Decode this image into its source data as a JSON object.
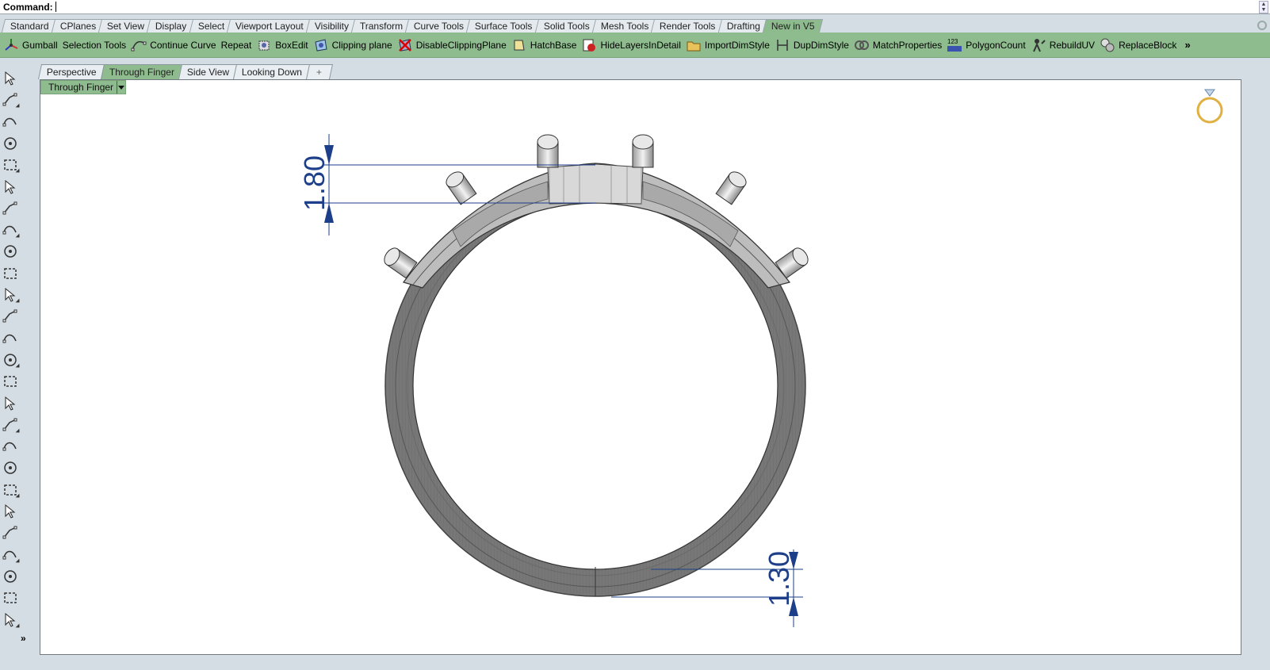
{
  "command": {
    "label": "Command:"
  },
  "toolbar_tabs": [
    {
      "label": "Standard"
    },
    {
      "label": "CPlanes"
    },
    {
      "label": "Set View"
    },
    {
      "label": "Display"
    },
    {
      "label": "Select"
    },
    {
      "label": "Viewport Layout"
    },
    {
      "label": "Visibility"
    },
    {
      "label": "Transform"
    },
    {
      "label": "Curve Tools"
    },
    {
      "label": "Surface Tools"
    },
    {
      "label": "Solid Tools"
    },
    {
      "label": "Mesh Tools"
    },
    {
      "label": "Render Tools"
    },
    {
      "label": "Drafting"
    },
    {
      "label": "New in V5",
      "active": true
    }
  ],
  "commands": [
    {
      "label": "Gumball",
      "icon": "gumball-icon"
    },
    {
      "label": "Selection Tools",
      "icon": "none"
    },
    {
      "label": "Continue Curve",
      "icon": "curve-icon"
    },
    {
      "label": "Repeat",
      "icon": "none"
    },
    {
      "label": "BoxEdit",
      "icon": "boxedit-icon"
    },
    {
      "label": "Clipping plane",
      "icon": "clipping-plane-icon"
    },
    {
      "label": "DisableClippingPlane",
      "icon": "disable-clipping-icon"
    },
    {
      "label": "HatchBase",
      "icon": "hatch-icon"
    },
    {
      "label": "HideLayersInDetail",
      "icon": "hide-layers-icon"
    },
    {
      "label": "ImportDimStyle",
      "icon": "folder-icon"
    },
    {
      "label": "DupDimStyle",
      "icon": "dupdim-icon"
    },
    {
      "label": "MatchProperties",
      "icon": "match-icon"
    },
    {
      "label": "PolygonCount",
      "icon": "polygon-count-icon",
      "icon_text": "123"
    },
    {
      "label": "RebuildUV",
      "icon": "rebuilduv-icon"
    },
    {
      "label": "ReplaceBlock",
      "icon": "replace-block-icon"
    }
  ],
  "more_label": "»",
  "viewport_tabs": [
    {
      "label": "Perspective"
    },
    {
      "label": "Through Finger",
      "active": true
    },
    {
      "label": "Side View"
    },
    {
      "label": "Looking Down"
    },
    {
      "label": "+"
    }
  ],
  "viewport": {
    "title": "Through Finger"
  },
  "dimensions": {
    "top": "1.80",
    "bottom": "1.30"
  },
  "left_tools_more": "»",
  "colors": {
    "accent_green": "#8ebc8e",
    "dimension_blue": "#1d3f8a"
  }
}
